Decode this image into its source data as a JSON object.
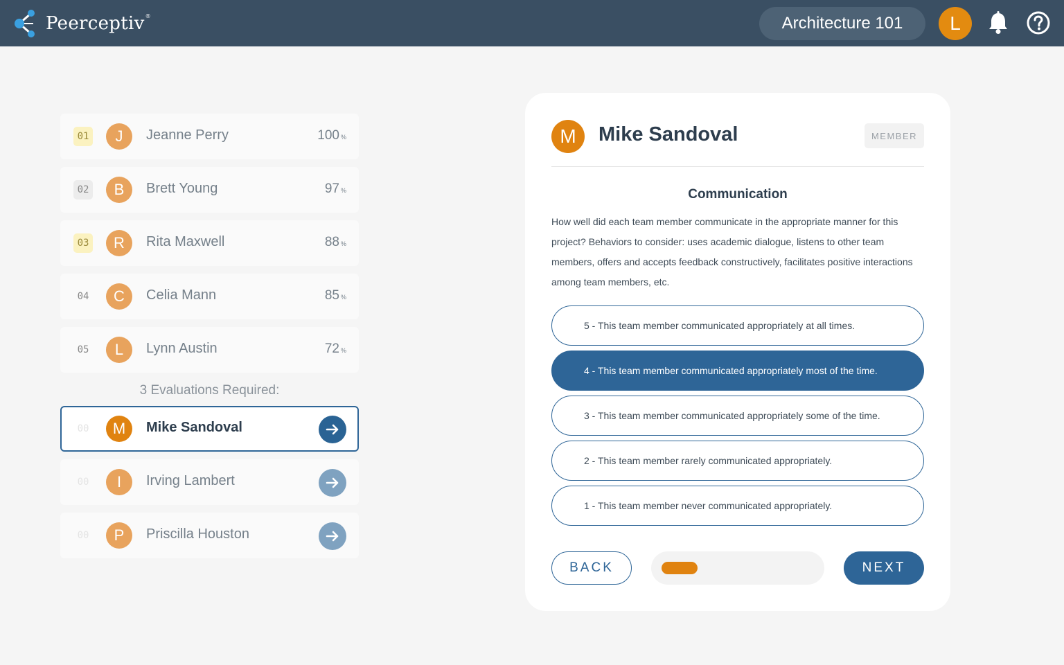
{
  "header": {
    "brand": "Peerceptiv",
    "brand_mark": "®",
    "course": "Architecture 101",
    "user_initial": "L"
  },
  "ranked": [
    {
      "rank": "01",
      "initial": "J",
      "name": "Jeanne Perry",
      "score": "100",
      "unit": "%"
    },
    {
      "rank": "02",
      "initial": "B",
      "name": "Brett Young",
      "score": "97",
      "unit": "%"
    },
    {
      "rank": "03",
      "initial": "R",
      "name": "Rita Maxwell",
      "score": "88",
      "unit": "%"
    },
    {
      "rank": "04",
      "initial": "C",
      "name": "Celia Mann",
      "score": "85",
      "unit": "%"
    },
    {
      "rank": "05",
      "initial": "L",
      "name": "Lynn Austin",
      "score": "72",
      "unit": "%"
    }
  ],
  "evaluations_required": "3 Evaluations Required:",
  "pending": [
    {
      "rank": "00",
      "initial": "M",
      "name": "Mike Sandoval"
    },
    {
      "rank": "00",
      "initial": "I",
      "name": "Irving Lambert"
    },
    {
      "rank": "00",
      "initial": "P",
      "name": "Priscilla Houston"
    }
  ],
  "card": {
    "initial": "M",
    "name": "Mike Sandoval",
    "role": "MEMBER",
    "criterion_title": "Communication",
    "criterion_desc": "How well did each team member communicate in the appropriate manner for this project? Behaviors to consider: uses academic dialogue, listens to other team members, offers and accepts feedback constructively, facilitates positive interactions among team members, etc.",
    "options": [
      "5 - This team member communicated appropriately at all times.",
      "4 - This team member communicated appropriately most of the time.",
      "3 - This team member communicated appropriately some of the time.",
      "2 - This team member rarely communicated appropriately.",
      "1 - This team member never communicated appropriately."
    ],
    "selected_option_index": 1,
    "back_label": "BACK",
    "next_label": "NEXT",
    "progress_fraction": 0.2
  },
  "colors": {
    "header_bg": "#3a4f63",
    "accent_orange": "#e08310",
    "primary_blue": "#2e6597"
  }
}
